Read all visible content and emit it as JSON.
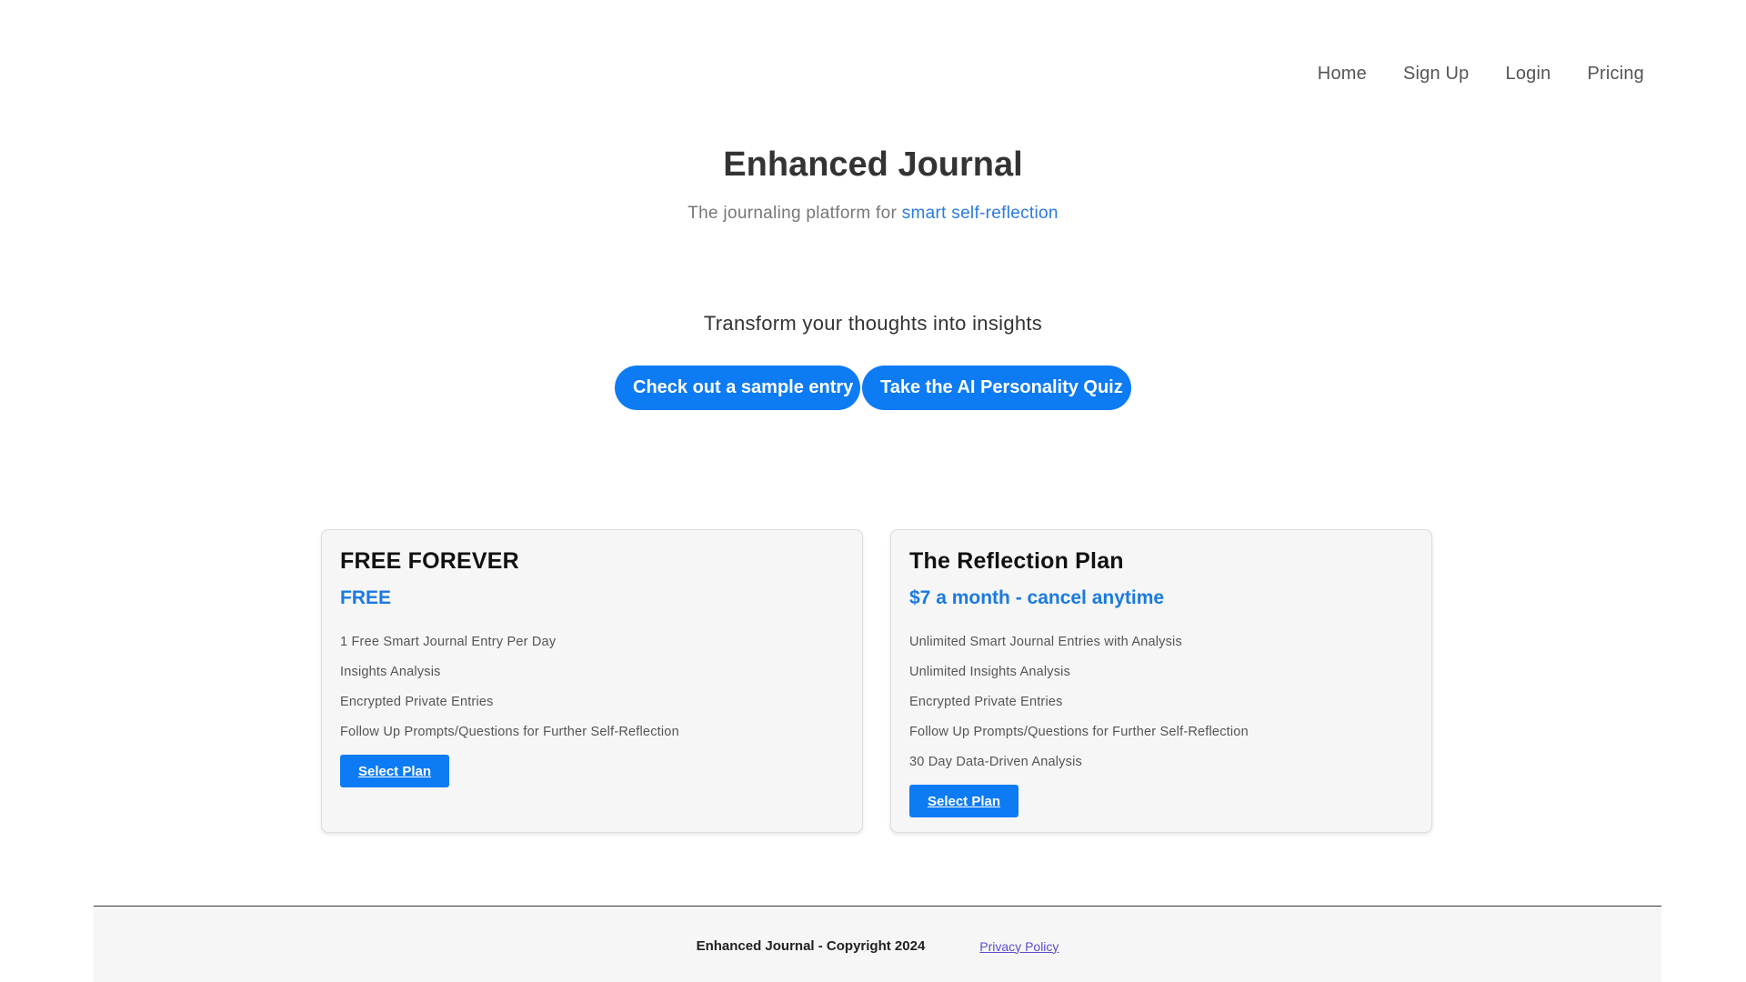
{
  "nav": {
    "items": [
      {
        "label": "Home"
      },
      {
        "label": "Sign Up"
      },
      {
        "label": "Login"
      },
      {
        "label": "Pricing"
      }
    ]
  },
  "hero": {
    "title": "Enhanced Journal",
    "subtitle_prefix": "The journaling platform for ",
    "subtitle_accent": "smart self-reflection",
    "tagline": "Transform your thoughts into insights",
    "cta_sample": "Check out a sample entry",
    "cta_quiz": "Take the AI Personality Quiz"
  },
  "plans": [
    {
      "name": "FREE FOREVER",
      "price": "FREE",
      "features": [
        "1 Free Smart Journal Entry Per Day",
        "Insights Analysis",
        "Encrypted Private Entries",
        "Follow Up Prompts/Questions for Further Self-Reflection"
      ],
      "button": "Select Plan"
    },
    {
      "name": "The Reflection Plan",
      "price": "$7 a month - cancel anytime",
      "features": [
        "Unlimited Smart Journal Entries with Analysis",
        "Unlimited Insights Analysis",
        "Encrypted Private Entries",
        "Follow Up Prompts/Questions for Further Self-Reflection",
        "30 Day Data-Driven Analysis"
      ],
      "button": "Select Plan"
    }
  ],
  "footer": {
    "copyright": "Enhanced Journal - Copyright 2024",
    "privacy": "Privacy Policy"
  },
  "colors": {
    "accent": "#0d7bf4",
    "link_accent": "#2a7ae2",
    "card_bg": "#f6f6f6"
  }
}
